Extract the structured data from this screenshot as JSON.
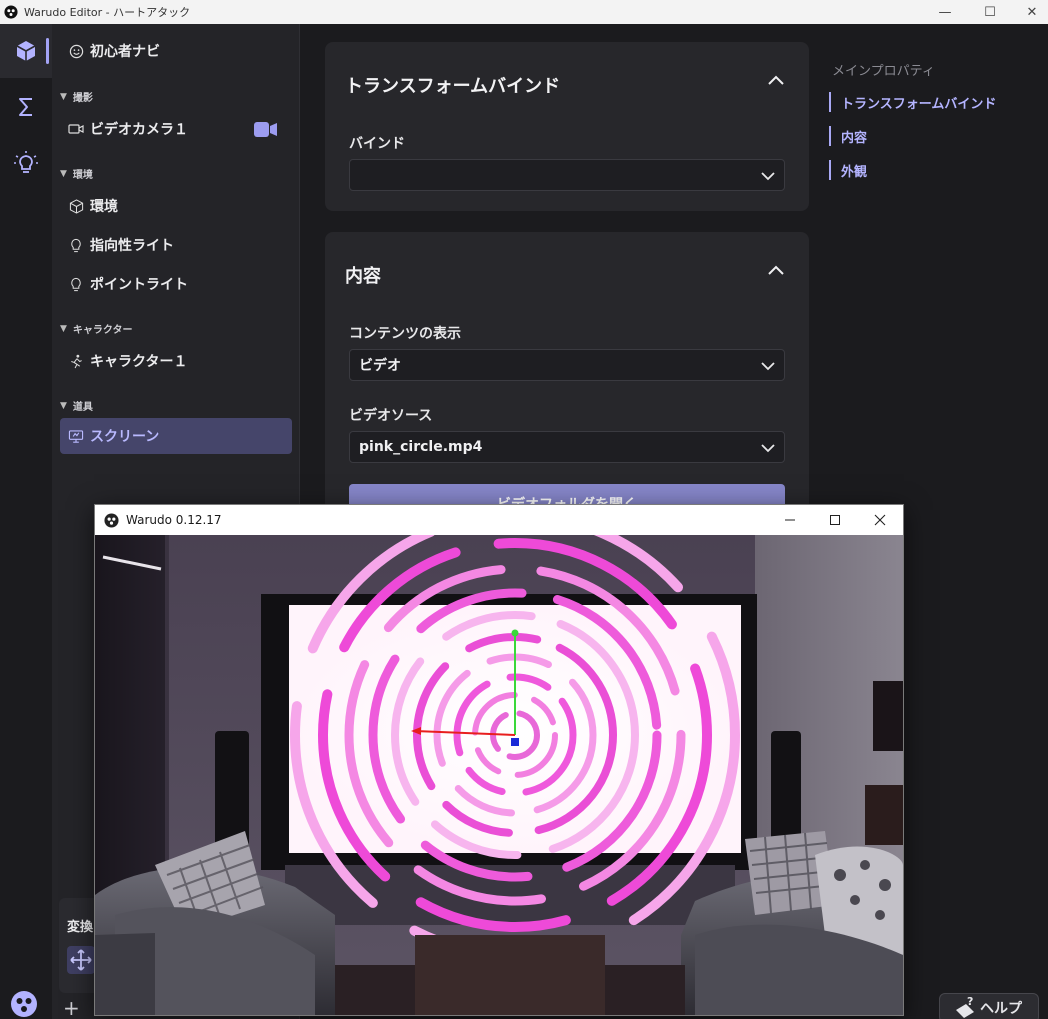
{
  "window": {
    "title": "Warudo Editor - ハートアタック",
    "controls": {
      "minimize": "—",
      "maximize": "☐",
      "close": "✕"
    }
  },
  "rail": {
    "items": [
      {
        "name": "scene-icon",
        "active": true
      },
      {
        "name": "blueprint-sigma-icon",
        "active": false
      },
      {
        "name": "lightbulb-icon",
        "active": false
      }
    ]
  },
  "tree": {
    "beginner": "初心者ナビ",
    "sections": {
      "camera": "撮影",
      "environment": "環境",
      "character": "キャラクター",
      "props": "道具"
    },
    "items": {
      "video_camera": "ビデオカメラ１",
      "environment": "環境",
      "directional_light": "指向性ライト",
      "point_light": "ポイントライト",
      "character": "キャラクター１",
      "screen": "スクリーン"
    }
  },
  "inspector": {
    "transform_bind": {
      "title": "トランスフォームバインド",
      "bind_label": "バインド",
      "bind_value": ""
    },
    "content": {
      "title": "内容",
      "display_label": "コンテンツの表示",
      "display_value": "ビデオ",
      "source_label": "ビデオソース",
      "source_value": "pink_circle.mp4",
      "open_folder_button": "ビデオフォルダを開く"
    }
  },
  "nav": {
    "heading": "メインプロパティ",
    "links": [
      "トランスフォームバインド",
      "内容",
      "外観"
    ]
  },
  "bottom": {
    "transform_label": "変換",
    "help_label": "ヘルプ"
  },
  "preview": {
    "title": "Warudo 0.12.17",
    "controls": {
      "minimize": "—",
      "maximize": "☐",
      "close": "✕"
    }
  },
  "colors": {
    "accent": "#a3a3f5",
    "selected_bg": "#45456a",
    "primary_button": "#8686c9",
    "panel_bg": "#27272b",
    "screen_pink": "#f058dc"
  }
}
